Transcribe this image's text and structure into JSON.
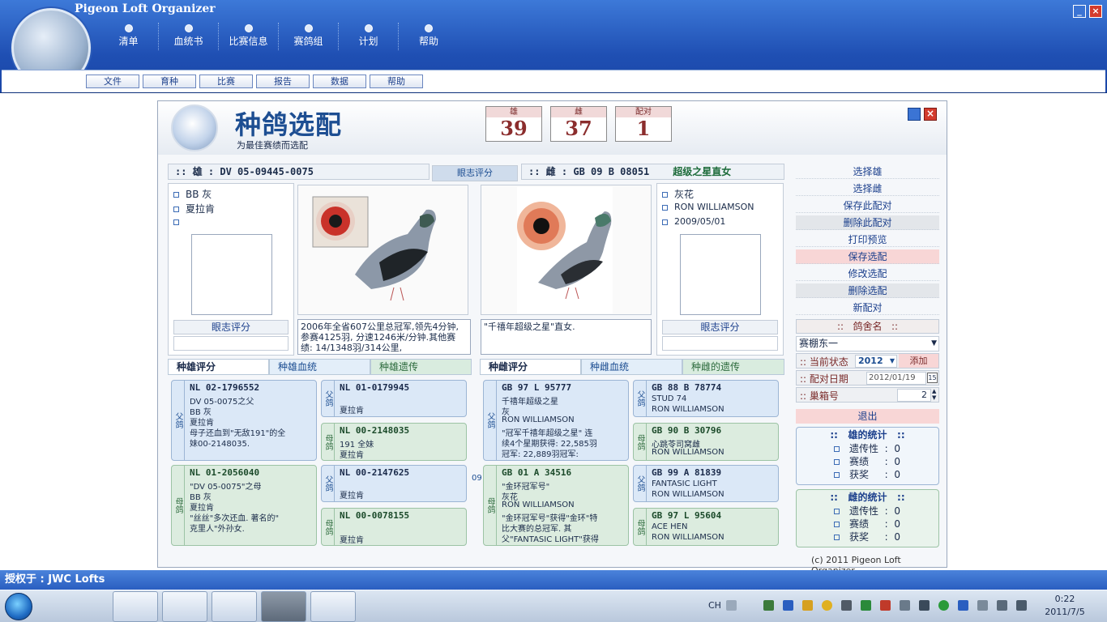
{
  "app": {
    "title": "Pigeon Loft Organizer",
    "main_menu": [
      "清单",
      "血统书",
      "比赛信息",
      "赛鸽组",
      "计划",
      "帮助"
    ],
    "sub_menu": [
      "文件",
      "育种",
      "比赛",
      "报告",
      "数据",
      "帮助"
    ]
  },
  "panel": {
    "title": "种鸽选配",
    "subtitle": "为最佳赛绩而选配",
    "counters": [
      {
        "label": "雄",
        "value": "39"
      },
      {
        "label": "雌",
        "value": "37"
      },
      {
        "label": "配对",
        "value": "1"
      }
    ],
    "cock": {
      "header": ":: 雄 : DV 05-09445-0075",
      "color": "BB 灰",
      "owner": "夏拉肯",
      "eye_rating_label": "眼志评分",
      "notes": "2006年全省607公里总冠军,领先4分钟,参赛4125羽, 分速1246米/分钟.其他赛绩: 14/1348羽/314公里,"
    },
    "eye_score_tab": "眼志评分",
    "hen": {
      "header": ":: 雌 : GB 09 B 08051",
      "name": "超级之星直女",
      "color": "灰花",
      "owner": "RON WILLIAMSON",
      "date": "2009/05/01",
      "eye_rating_label": "眼志评分",
      "notes": "\"千禧年超级之星\"直女."
    },
    "cock_tabs": [
      "种雄评分",
      "种雄血统",
      "种雄遗传"
    ],
    "hen_tabs": [
      "种雌评分",
      "种雌血统",
      "种雌的遗传"
    ],
    "cock_pedigree": {
      "sire": {
        "side": "父鸽",
        "ring": "NL 02-1796552",
        "lines": [
          "DV 05-0075之父",
          "BB 灰",
          "夏拉肯",
          "母子还血到\"无敌191\"的全",
          "妹00-2148035."
        ]
      },
      "sire_sire": {
        "side": "父鸽",
        "ring": "NL 01-0179945",
        "lines": [
          "夏拉肯"
        ]
      },
      "sire_dam": {
        "side": "母鸽",
        "ring": "NL 00-2148035",
        "lines": [
          "191 全妹",
          "夏拉肯"
        ]
      },
      "dam": {
        "side": "母鸽",
        "ring": "NL 01-2056040",
        "lines": [
          "\"DV 05-0075\"之母",
          "BB 灰",
          "夏拉肯",
          "\"丝丝\"多次还血. 著名的\"",
          "克里人\"外孙女."
        ]
      },
      "dam_sire": {
        "side": "父鸽",
        "ring": "NL 00-2147625",
        "lines": [
          "夏拉肯"
        ]
      },
      "dam_dam": {
        "side": "母鸽",
        "ring": "NL 00-0078155",
        "lines": [
          "夏拉肯"
        ]
      }
    },
    "hen_pedigree": {
      "sire": {
        "side": "父鸽",
        "ring": "GB 97 L 95777",
        "lines": [
          "千禧年超级之星",
          "灰",
          "RON WILLIAMSON",
          "\"冠军千禧年超级之星\" 连",
          "续4个星期获得: 22,585羽",
          "冠军: 22,889羽冠军:"
        ]
      },
      "sire_sire": {
        "side": "父鸽",
        "ring": "GB 88 B 78774",
        "lines": [
          "STUD 74",
          "RON WILLIAMSON"
        ]
      },
      "sire_dam": {
        "side": "母鸽",
        "ring": "GB 90 B 30796",
        "lines": [
          "心跳苓司窝雌",
          "RON WILLIAMSON"
        ]
      },
      "dam": {
        "side": "母鸽",
        "ring": "GB 01 A 34516",
        "lines": [
          "\"金环冠军号\"",
          "灰花",
          "RON WILLIAMSON",
          "\"金环冠军号\"获得\"金环\"特",
          "比大赛的总冠军. 其",
          "父\"FANTASIC LIGHT\"获得"
        ]
      },
      "dam_sire": {
        "side": "父鸽",
        "ring": "GB 99 A 81839",
        "lines": [
          "FANTASIC LIGHT",
          "RON WILLIAMSON"
        ]
      },
      "dam_dam": {
        "side": "母鸽",
        "ring": "GB 97 L 95604",
        "lines": [
          "ACE HEN",
          "RON WILLIAMSON"
        ]
      }
    },
    "side_buttons": [
      "选择雄",
      "选择雌",
      "保存此配对",
      "删除此配对",
      "打印预览",
      "保存选配",
      "修改选配",
      "删除选配",
      "新配对"
    ],
    "loft_label": "鸽舍名",
    "loft_value": "赛棚东一",
    "status_label": "当前状态",
    "status_year": "2012",
    "add_label": "添加",
    "pair_date_label": "配对日期",
    "pair_date": "2012/01/19",
    "nest_label": "巢箱号",
    "nest_value": "2",
    "exit_label": "退出",
    "cock_stats": {
      "title": "雄的统计",
      "rows": [
        {
          "k": "遗传性",
          "v": "0"
        },
        {
          "k": "赛绩",
          "v": "0"
        },
        {
          "k": "获奖",
          "v": "0"
        }
      ]
    },
    "hen_stats": {
      "title": "雌的统计",
      "rows": [
        {
          "k": "遗传性",
          "v": "0"
        },
        {
          "k": "赛绩",
          "v": "0"
        },
        {
          "k": "获奖",
          "v": "0"
        }
      ]
    },
    "copyright": "(c) 2011 Pigeon Loft Organizer",
    "scroll_marker": "09"
  },
  "status_bar": "授权于 : JWC Lofts",
  "taskbar": {
    "lang": "CH",
    "time": "0:22",
    "date": "2011/7/5"
  },
  "colors": {
    "header_blue": "#2458bd",
    "pink_button": "#f8d6d6",
    "pedigree_blue": "#dbe8f7",
    "pedigree_green": "#dcecdf"
  }
}
